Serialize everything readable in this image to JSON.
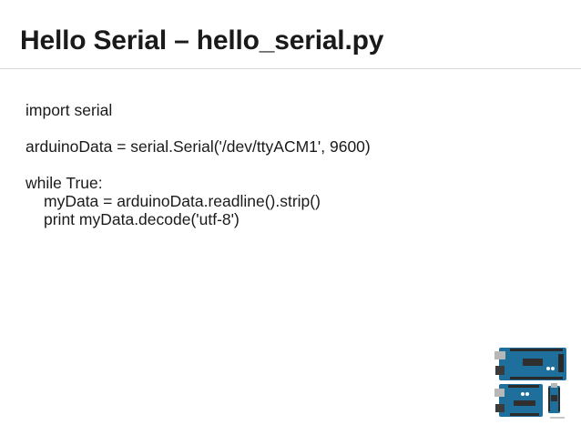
{
  "slide": {
    "title": "Hello Serial – hello_serial.py"
  },
  "code": {
    "lines": [
      {
        "text": "import serial",
        "indent": 0
      },
      {
        "text": "",
        "indent": 0
      },
      {
        "text": "arduinoData = serial.Serial('/dev/ttyACM1', 9600)",
        "indent": 0
      },
      {
        "text": "",
        "indent": 0
      },
      {
        "text": "while True:",
        "indent": 0
      },
      {
        "text": "myData = arduinoData.readline().strip()",
        "indent": 1
      },
      {
        "text": "print myData.decode('utf-8')",
        "indent": 1
      }
    ]
  },
  "image": {
    "description_icon": "arduino-boards-icon",
    "board_color": "#1e6f9c"
  }
}
